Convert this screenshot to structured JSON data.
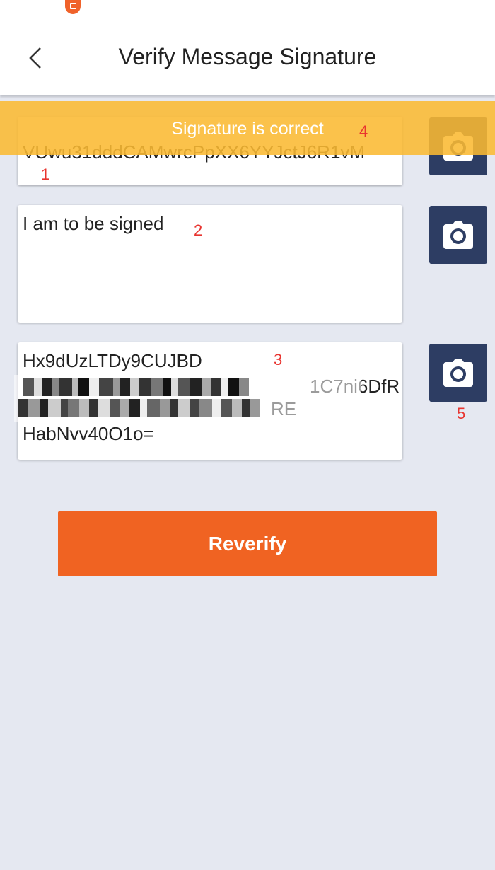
{
  "header": {
    "title": "Verify Message Signature"
  },
  "fields": {
    "address_value": "VUwu31dddCAMwrcPpXX6YYJctJ6R1vM",
    "message_value": "I am to be signed",
    "signature_line1": "Hx9dUzLTDy9CUJBD",
    "signature_line2_visible": "1C7ni6DfR",
    "signature_line3_visible": "RE",
    "signature_line4": "HabNvv40O1o="
  },
  "toast": {
    "message": "Signature is correct"
  },
  "markers": {
    "m1": "1",
    "m2": "2",
    "m3": "3",
    "m4": "4",
    "m5": "5"
  },
  "actions": {
    "reverify_label": "Reverify"
  },
  "icons": {
    "back": "chevron-left-icon",
    "camera": "camera-icon"
  },
  "colors": {
    "primary": "#f06322",
    "camera_button": "#2d3d63",
    "toast": "#fbb932",
    "background": "#e5e8f1"
  }
}
